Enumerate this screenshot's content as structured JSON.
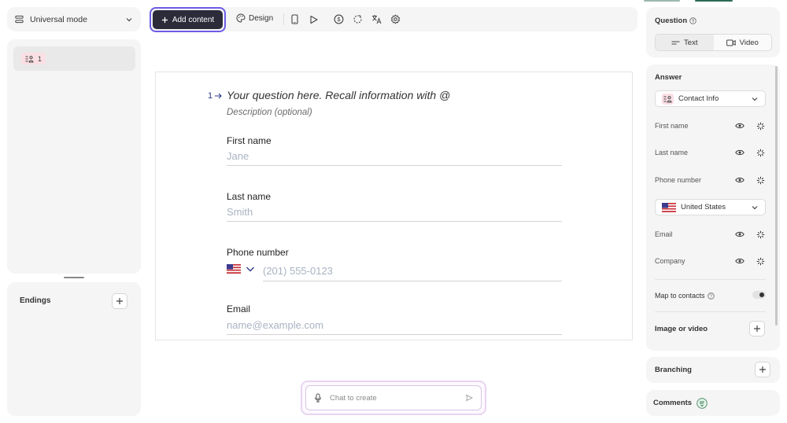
{
  "mode_selector": {
    "label": "Universal mode",
    "icon": "stack-icon"
  },
  "pages": [
    {
      "number": "1",
      "icon": "contact-info-icon"
    }
  ],
  "endings": {
    "title": "Endings"
  },
  "toolbar": {
    "add_content_label": "Add content",
    "design_label": "Design",
    "icons": [
      "mobile-preview-icon",
      "play-icon",
      "dollar-icon",
      "logic-icon",
      "translate-icon",
      "settings-icon"
    ]
  },
  "question": {
    "number": "1",
    "title_placeholder": "Your question here. Recall information with @",
    "description_placeholder": "Description (optional)",
    "fields": [
      {
        "label": "First name",
        "placeholder": "Jane"
      },
      {
        "label": "Last name",
        "placeholder": "Smith"
      },
      {
        "label": "Phone number",
        "placeholder": "(201) 555-0123"
      },
      {
        "label": "Email",
        "placeholder": "name@example.com"
      }
    ]
  },
  "chat": {
    "placeholder": "Chat to create"
  },
  "sidebar": {
    "question_title": "Question",
    "tabs": [
      {
        "label": "Text",
        "active": true
      },
      {
        "label": "Video",
        "active": false
      }
    ],
    "answer_title": "Answer",
    "answer_type": "Contact Info",
    "answer_fields": [
      "First name",
      "Last name",
      "Phone number",
      "Email",
      "Company"
    ],
    "country": "United States",
    "map_to_contacts": "Map to contacts",
    "map_to_contacts_enabled": false,
    "image_or_video": "Image or video",
    "branching": "Branching",
    "comments": "Comments"
  },
  "colors": {
    "accent": "#6c5ce7",
    "primary_button": "#2b2b3a",
    "badge_bg": "#fadfe5",
    "link_blue": "#2d3a8c"
  }
}
